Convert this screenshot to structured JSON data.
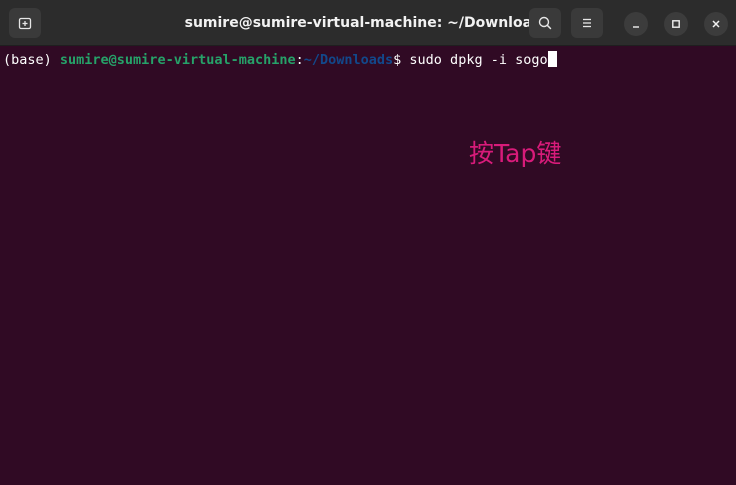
{
  "window": {
    "title": "sumire@sumire-virtual-machine: ~/Downloads"
  },
  "titlebar": {
    "new_tab_icon": "new-tab-icon",
    "search_icon": "search-icon",
    "menu_icon": "hamburger-menu-icon",
    "minimize_icon": "minimize-icon",
    "maximize_icon": "maximize-icon",
    "close_icon": "close-icon"
  },
  "terminal": {
    "env": "(base) ",
    "user_host": "sumire@sumire-virtual-machine",
    "colon": ":",
    "cwd": "~/Downloads",
    "prompt_symbol": "$ ",
    "command": "sudo dpkg -i sogo"
  },
  "annotation": {
    "text": "按Tap键",
    "color": "#d81b7a"
  },
  "colors": {
    "background": "#300a24",
    "titlebar": "#2c2c2c",
    "user_host": "#26a269",
    "path": "#12488b",
    "text": "#ffffff"
  }
}
